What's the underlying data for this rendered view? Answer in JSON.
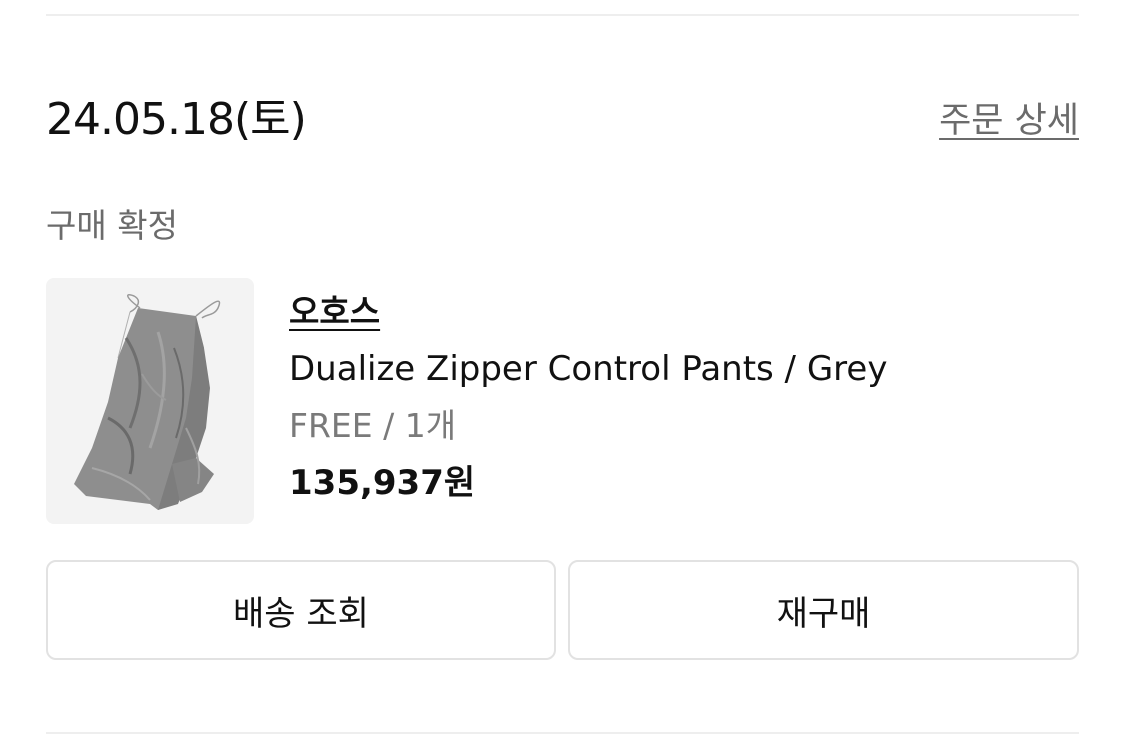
{
  "order": {
    "date": "24.05.18(토)",
    "detail_link": "주문 상세",
    "status": "구매 확정"
  },
  "product": {
    "brand": "오호스",
    "name": "Dualize Zipper Control Pants / Grey",
    "option": "FREE / 1개",
    "price": "135,937원",
    "image": "grey-pants-photo"
  },
  "actions": {
    "track_shipping": "배송 조회",
    "reorder": "재구매"
  }
}
